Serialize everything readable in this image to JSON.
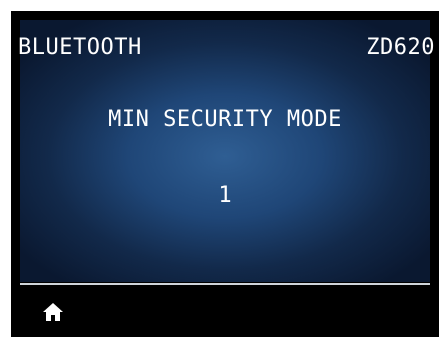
{
  "header": {
    "title": "BLUETOOTH",
    "model": "ZD620"
  },
  "setting": {
    "name": "MIN SECURITY MODE",
    "value": "1"
  },
  "footer": {
    "home_icon": "home-icon"
  },
  "colors": {
    "screen_center": "#2f5e93",
    "screen_edge": "#0a1830",
    "bezel": "#000000",
    "text": "#ffffff",
    "divider": "#cfd4da"
  }
}
